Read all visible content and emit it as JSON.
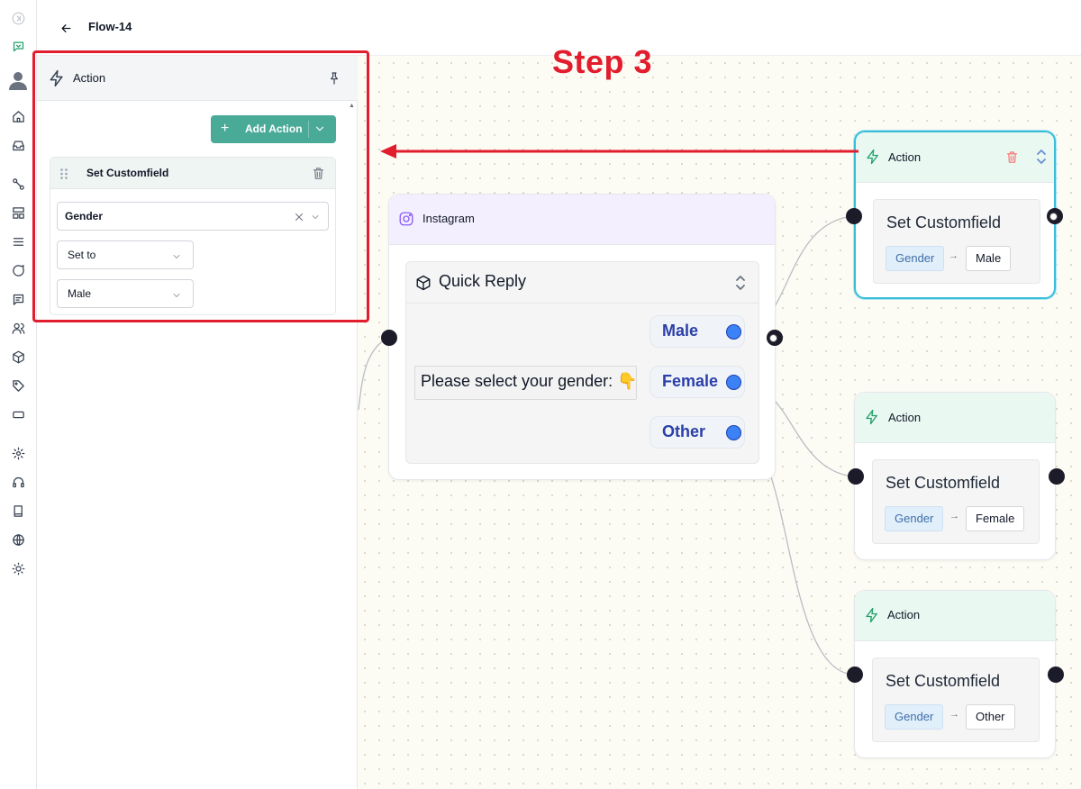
{
  "header": {
    "flow_title": "Flow-14"
  },
  "annotation": {
    "step_label": "Step 3"
  },
  "rail": {
    "items": [
      "collapse-icon",
      "chat-bot-icon",
      "user-avatar-icon",
      "home-icon",
      "inbox-icon",
      "flows-icon",
      "layout-icon",
      "list-icon",
      "chat-icon",
      "message-icon",
      "contacts-icon",
      "box-icon",
      "tag-icon",
      "credit-card-icon",
      "settings-icon",
      "headset-icon",
      "book-icon",
      "globe-icon",
      "sun-icon"
    ]
  },
  "panel": {
    "title": "Action",
    "add_action_label": "Add Action",
    "card": {
      "title": "Set Customfield",
      "field_value": "Gender",
      "operation_value": "Set to",
      "value_value": "Male"
    }
  },
  "flow": {
    "instagram_node": {
      "title": "Instagram",
      "quick_reply_title": "Quick Reply",
      "message": "Please select your gender: 👇",
      "buttons": [
        {
          "label": "Male"
        },
        {
          "label": "Female"
        },
        {
          "label": "Other"
        }
      ]
    },
    "action_nodes": [
      {
        "title": "Action",
        "set_title": "Set Customfield",
        "field": "Gender",
        "arrow": "→",
        "value": "Male"
      },
      {
        "title": "Action",
        "set_title": "Set Customfield",
        "field": "Gender",
        "arrow": "→",
        "value": "Female"
      },
      {
        "title": "Action",
        "set_title": "Set Customfield",
        "field": "Gender",
        "arrow": "→",
        "value": "Other"
      }
    ]
  },
  "colors": {
    "accent_teal": "#4aaa98",
    "highlight_red": "#e11d2e",
    "selected_border": "#38bdd8",
    "qr_port_blue": "#3b82f6"
  }
}
